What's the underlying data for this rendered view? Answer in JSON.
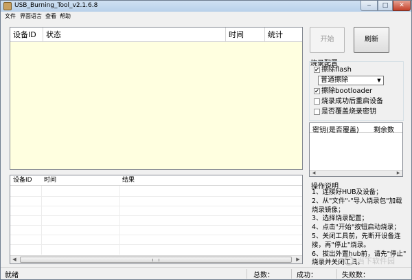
{
  "window": {
    "title": "USB_Burning_Tool_v2.1.6.8",
    "controls": {
      "minimize": "‒",
      "maximize": "□",
      "close": "✕"
    }
  },
  "menu": [
    "文件",
    "界面语言",
    "查看",
    "帮助"
  ],
  "device_grid": {
    "columns": [
      "设备ID",
      "状态",
      "时间",
      "统计"
    ],
    "background": "#ffffe0"
  },
  "result_grid": {
    "columns": [
      "设备ID",
      "时间",
      "结果"
    ]
  },
  "buttons": {
    "start": "开始",
    "refresh": "刷新"
  },
  "config": {
    "title": "烧录配置",
    "erase_flash": {
      "label": "擦除flash",
      "checked": true
    },
    "erase_mode": "普通擦除",
    "erase_bootloader": {
      "label": "擦除bootloader",
      "checked": true
    },
    "reset_after": {
      "label": "烧录成功后重启设备",
      "checked": false
    },
    "overwrite_key": {
      "label": "是否覆盖烧录密钥",
      "checked": false
    }
  },
  "key_table": {
    "columns": [
      "密钥(是否覆盖)",
      "剩余数"
    ]
  },
  "help": {
    "title": "操作说明",
    "lines": [
      "1、连接好HUB及设备；",
      "2、从\"文件\"-\"导入烧录包\"加载",
      "烧录镜像；",
      "3、选择烧录配置；",
      "4、点击\"开始\"按钮启动烧录；",
      "5、关闭工具前，先断开设备连",
      "接，再\"停止\"烧录。",
      "6、拔出外置hub前，请先\"停止\"",
      "烧录并关闭工具。"
    ]
  },
  "status": {
    "ready": "就绪",
    "total": "总数：",
    "success": "成功：",
    "fail": "失败数："
  },
  "watermark": "当下软件园",
  "icons": {
    "check": "✔",
    "dropdown": "▼",
    "scroll_left": "◀",
    "scroll_right": "▶"
  }
}
